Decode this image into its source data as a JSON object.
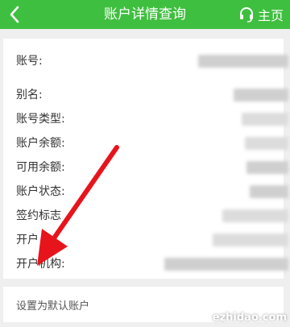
{
  "header": {
    "title": "账户详情查询",
    "home_label": "主页"
  },
  "details": {
    "account_no": "账号:",
    "alias": "别名:",
    "account_type": "账号类型:",
    "balance": "账户余额:",
    "available": "可用余额:",
    "status": "账户状态:",
    "signing_flag": "签约标志",
    "opening": "开户",
    "institution": "开户机构:"
  },
  "settings": {
    "default_account": "设置为默认账户"
  },
  "colors": {
    "header_bg": "#3fbf3f",
    "arrow": "#e8141c"
  },
  "watermark": "ezhidao.com"
}
